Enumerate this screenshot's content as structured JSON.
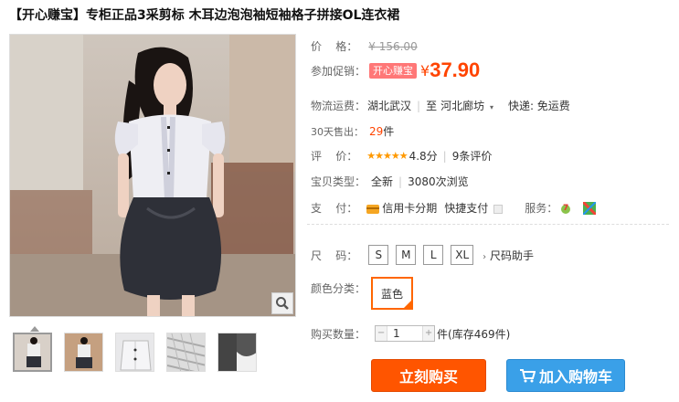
{
  "title": "【开心赚宝】专柜正品3采剪标 木耳边泡泡袖短袖格子拼接OL连衣裙",
  "price": {
    "label": "价    格：",
    "original": "¥ 156.00"
  },
  "promo": {
    "label": "参加促销：",
    "tag": "开心赚宝",
    "currency": "¥",
    "value": "37.90"
  },
  "shipping": {
    "label": "物流运费：",
    "from": "湖北武汉",
    "to_prefix": "至",
    "to": "河北廊坊",
    "method": "快递: 免运费"
  },
  "sales": {
    "label": "30天售出：",
    "count": "29",
    "unit": "件"
  },
  "rating": {
    "label": "评    价：",
    "stars": "★★★★★",
    "score": "4.8分",
    "reviews": "9条评价"
  },
  "item_type": {
    "label": "宝贝类型：",
    "condition": "全新",
    "views": "3080次浏览"
  },
  "payment": {
    "label": "支    付：",
    "installment": "信用卡分期",
    "quick": "快捷支付",
    "service_label": "服务："
  },
  "size": {
    "label": "尺    码：",
    "options": [
      "S",
      "M",
      "L",
      "XL"
    ],
    "helper": "尺码助手"
  },
  "color": {
    "label": "颜色分类：",
    "selected": "蓝色"
  },
  "quantity": {
    "label": "购买数量：",
    "value": "1",
    "unit": "件",
    "stock": "(库存469件)"
  },
  "actions": {
    "buy": "立刻购买",
    "cart": "加入购物车"
  },
  "colors": {
    "accent": "#ff4400",
    "cart_blue": "#3aa0e8",
    "promo_tag": "#ff7777",
    "star": "#ff9900"
  }
}
